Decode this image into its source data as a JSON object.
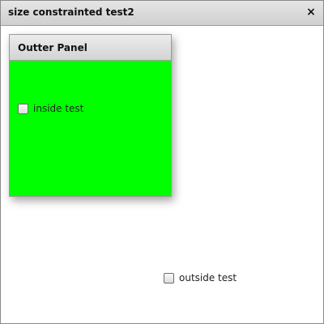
{
  "window": {
    "title": "size constrainted test2",
    "close_icon": "×"
  },
  "panel": {
    "title": "Outter Panel",
    "background_color": "#00ff00",
    "checkbox": {
      "label": "inside test",
      "checked": false
    }
  },
  "outside_checkbox": {
    "label": "outside test",
    "checked": false
  }
}
